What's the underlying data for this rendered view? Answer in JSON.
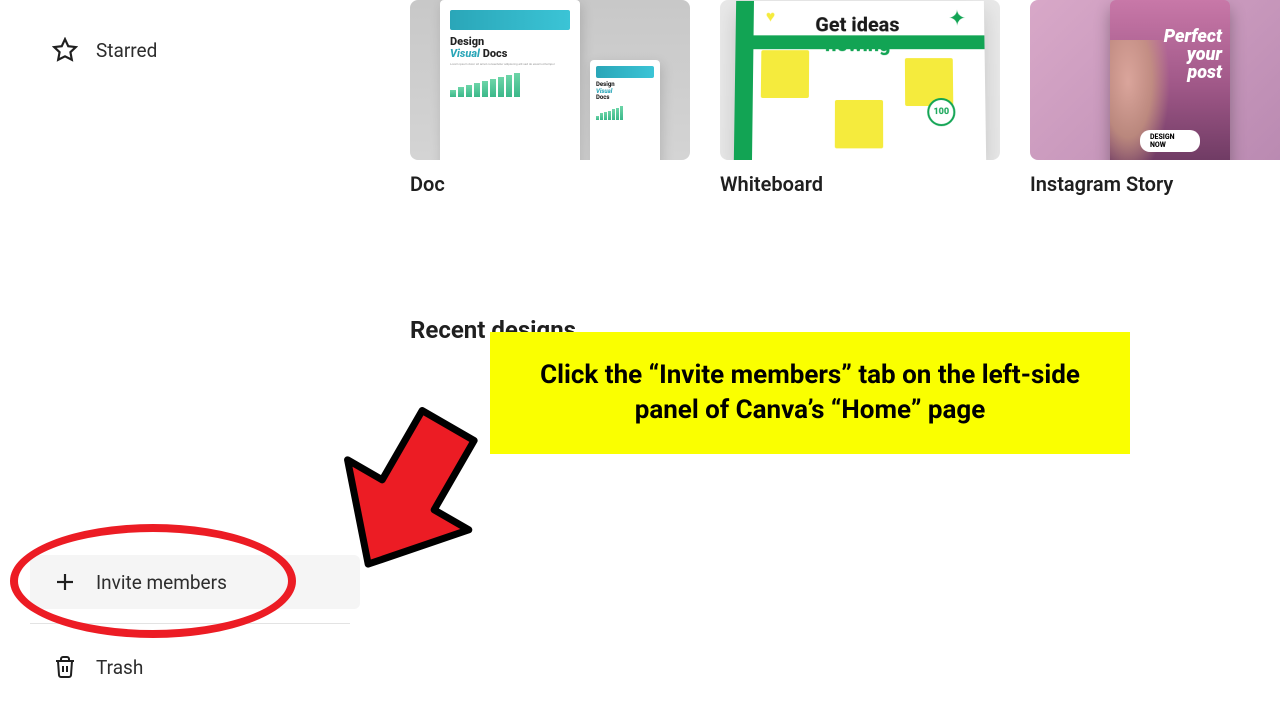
{
  "sidebar": {
    "starred_label": "Starred",
    "invite_label": "Invite members",
    "trash_label": "Trash"
  },
  "templates": {
    "doc": {
      "label": "Doc",
      "headline_1": "Design",
      "headline_2": "Visual",
      "headline_3": "Docs"
    },
    "whiteboard": {
      "label": "Whiteboard",
      "headline_1": "Get ideas",
      "headline_2": "flowing",
      "badge": "100"
    },
    "instagram": {
      "label": "Instagram Story",
      "headline_1": "Perfect",
      "headline_2": "your",
      "headline_3": "post",
      "cta": "DESIGN NOW"
    }
  },
  "section": {
    "recent": "Recent designs"
  },
  "annotation": {
    "text": "Click the “Invite members” tab on the left-side panel of Canva’s “Home” page"
  }
}
